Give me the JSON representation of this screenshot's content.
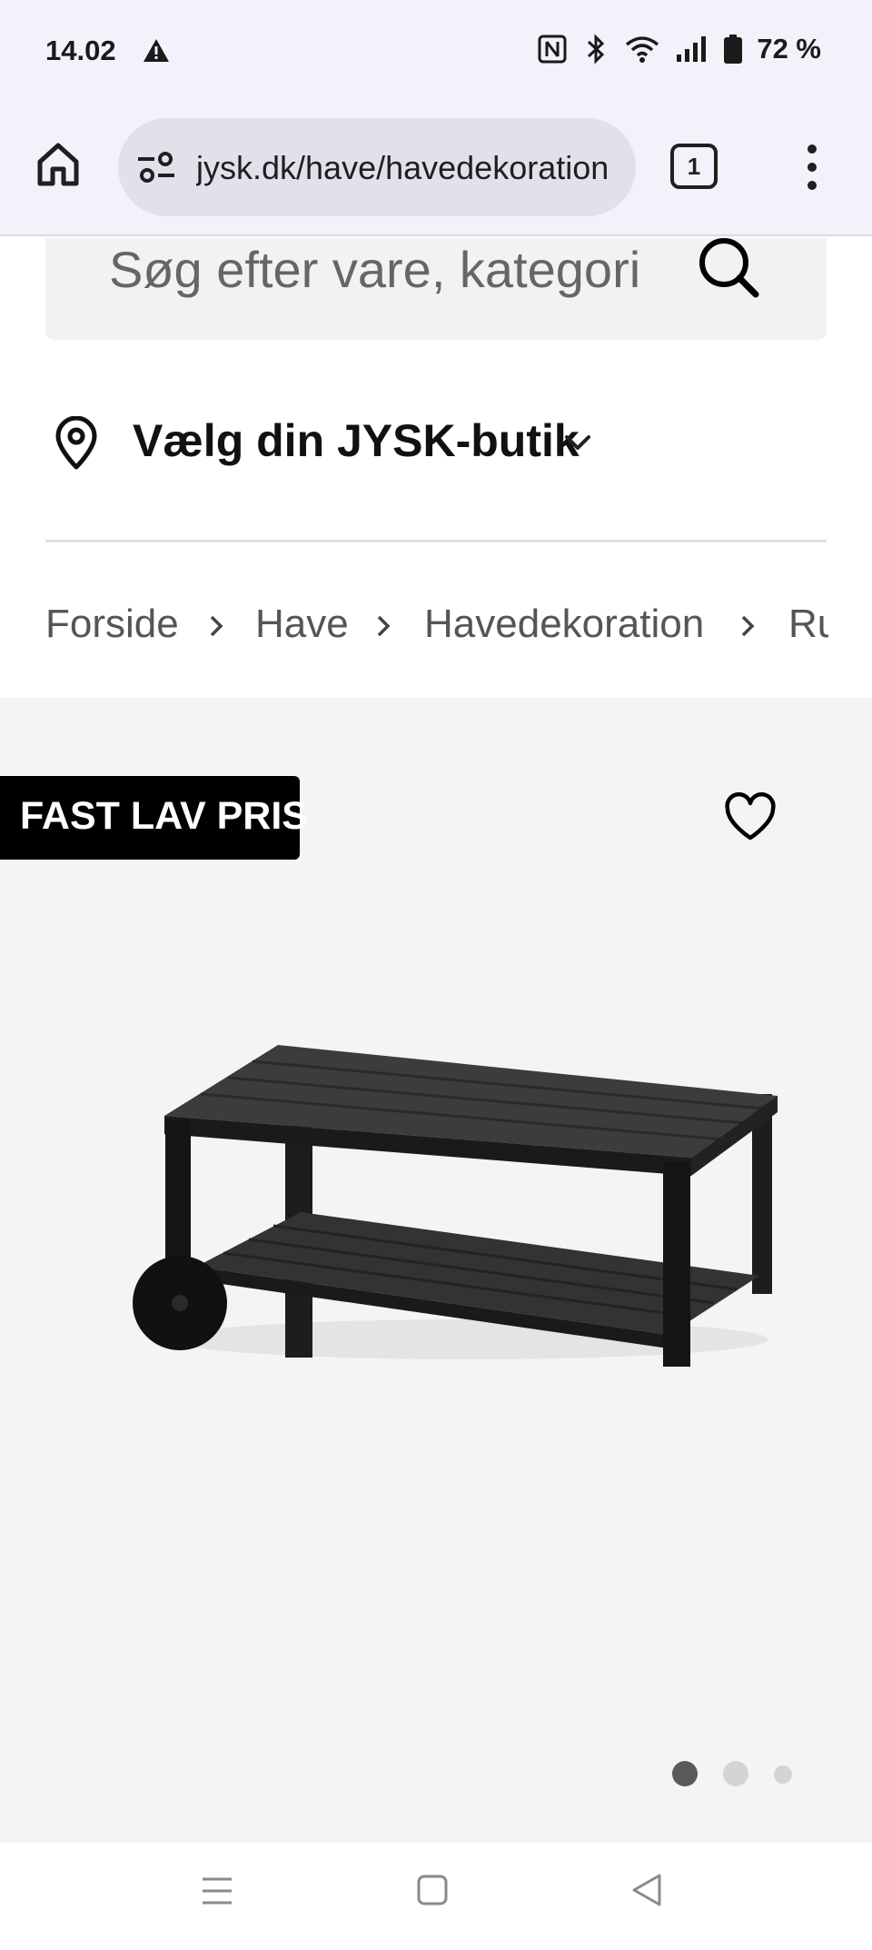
{
  "status_bar": {
    "time": "14.02",
    "battery": "72 %",
    "icons": [
      "warning-icon",
      "nfc-icon",
      "bluetooth-icon",
      "wifi-icon",
      "signal-icon",
      "battery-icon"
    ]
  },
  "browser": {
    "url": "jysk.dk/have/havedekoration",
    "tab_count": "1",
    "icons": [
      "home-icon",
      "site-settings-icon",
      "more-vert-icon"
    ]
  },
  "search": {
    "placeholder": "Søg efter vare, kategori"
  },
  "store_selector": {
    "label": "Vælg din JYSK-butik"
  },
  "breadcrumb": {
    "items": [
      "Forside",
      "Have",
      "Havedekoration",
      "Ru"
    ]
  },
  "product": {
    "badge": "FAST LAV PRIS",
    "image_count": 3,
    "active_image": 1
  },
  "android_nav": {
    "icons": [
      "recents-icon",
      "home-icon",
      "back-icon"
    ]
  }
}
